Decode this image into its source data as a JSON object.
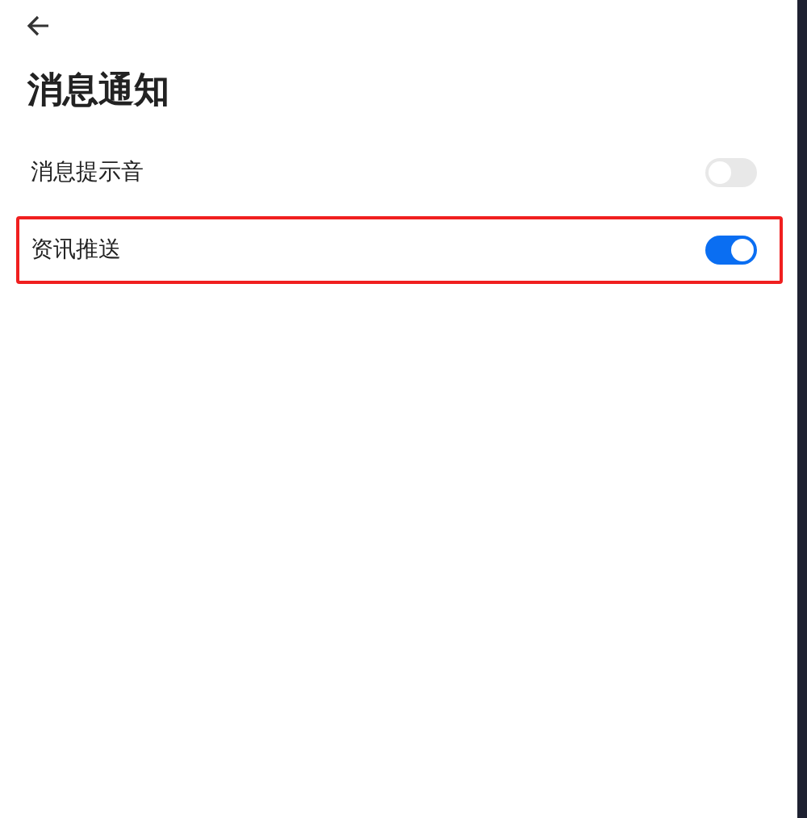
{
  "header": {
    "title": "消息通知"
  },
  "settings": [
    {
      "label": "消息提示音",
      "on": false,
      "highlighted": false
    },
    {
      "label": "资讯推送",
      "on": true,
      "highlighted": true
    }
  ]
}
